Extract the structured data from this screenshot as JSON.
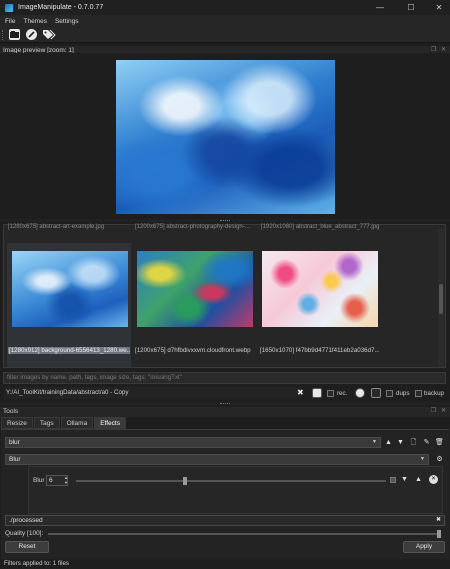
{
  "window": {
    "title": "ImageManipulate - 0.7.0.77",
    "minimize": "—",
    "maximize": "☐",
    "close": "✕"
  },
  "menu": [
    "File",
    "Themes",
    "Settings"
  ],
  "toolbar_icons": [
    "open-folder-icon",
    "edit-icon",
    "tags-icon"
  ],
  "preview": {
    "title": "Image preview [zoom: 1]"
  },
  "gallery": {
    "cut_labels": [
      "[1280x675] abstract-art-example.jpg",
      "[1200x675] abstract-photography-design-...",
      "[1920x1080] abstract_blue_abstract_777.jpg"
    ],
    "items": [
      {
        "caption": "[1280x912] background-6556413_1280.we...",
        "selected": true
      },
      {
        "caption": "[1200x675] d7hfbdivxxvm.cloudfront.webp",
        "selected": false
      },
      {
        "caption": "[1650x1070] f47bb9d4771f411eb2a036d7...",
        "selected": false
      }
    ]
  },
  "filter": {
    "placeholder": "filter images by name, path, tags, image size, tags: \"missingTxt\""
  },
  "path": {
    "value": "Y:/AI_ToolKit/trainingData/abstract/a0 - Copy",
    "rec_label": "rec.",
    "dups_label": "dups",
    "backup_label": "backup"
  },
  "tools": {
    "title": "Tools",
    "tabs": [
      "Resize",
      "Tags",
      "Ollama",
      "Effects"
    ],
    "active_tab": "Effects",
    "preset_value": "blur",
    "effect_value": "Blur",
    "param": {
      "label": "Blur",
      "value": "6",
      "level": 0.35
    },
    "output_path": "./processed",
    "quality_label": "Quality [100]:",
    "quality_level": 1.0,
    "reset_label": "Reset",
    "apply_label": "Apply"
  },
  "status": {
    "text": "Filters applied to: 1 files"
  }
}
